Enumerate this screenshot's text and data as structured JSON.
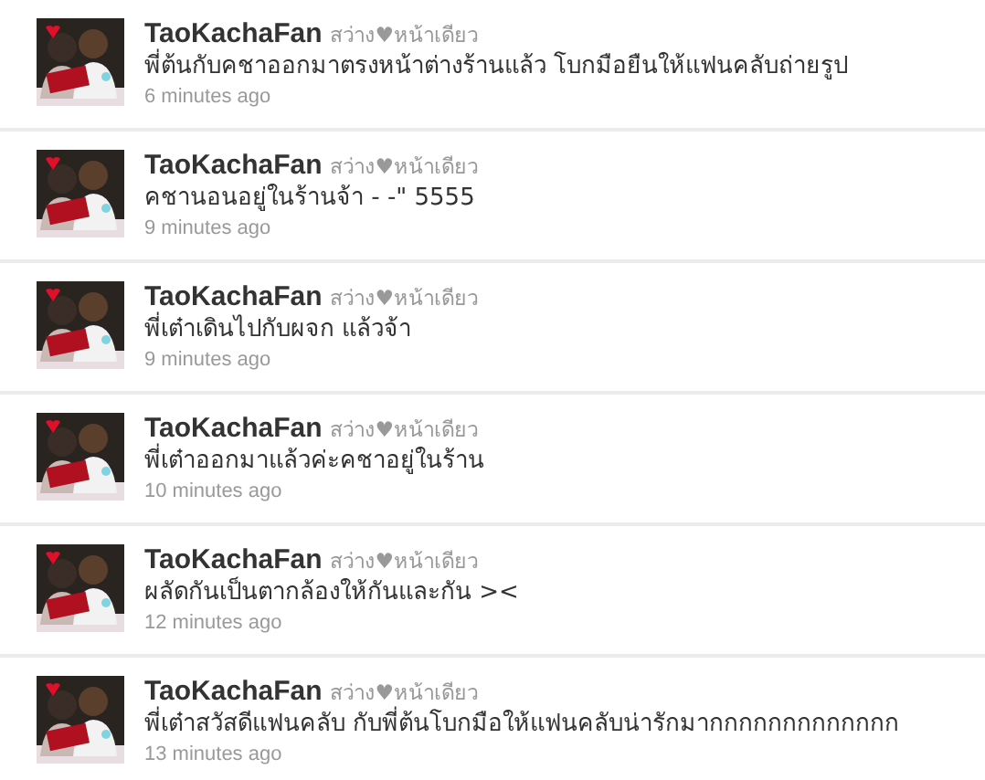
{
  "tweets": [
    {
      "name": "TaoKachaFan",
      "handle": "สว่าง♥หน้าเดียว",
      "text": "พี่ต้นกับคชาออกมาตรงหน้าต่างร้านแล้ว โบกมือยืนให้แฟนคลับถ่ายรูป",
      "time": "6 minutes ago"
    },
    {
      "name": "TaoKachaFan",
      "handle": "สว่าง♥หน้าเดียว",
      "text": "คชานอนอยู่ในร้านจ้า - -\" 5555",
      "time": "9 minutes ago"
    },
    {
      "name": "TaoKachaFan",
      "handle": "สว่าง♥หน้าเดียว",
      "text": "พี่เต๋าเดินไปกับผจก แล้วจ้า",
      "time": "9 minutes ago"
    },
    {
      "name": "TaoKachaFan",
      "handle": "สว่าง♥หน้าเดียว",
      "text": "พี่เต๋าออกมาแล้วค่ะคชาอยู่ในร้าน",
      "time": "10 minutes ago"
    },
    {
      "name": "TaoKachaFan",
      "handle": "สว่าง♥หน้าเดียว",
      "text": "ผลัดกันเป็นตากล้องให้กันและกัน ><",
      "time": "12 minutes ago"
    },
    {
      "name": "TaoKachaFan",
      "handle": "สว่าง♥หน้าเดียว",
      "text": "พี่เต๋าสวัสดีแฟนคลับ กับพี่ต้นโบกมือให้แฟนคลับน่ารักมากกกกกกกกกกกกก",
      "time": "13 minutes ago"
    }
  ]
}
